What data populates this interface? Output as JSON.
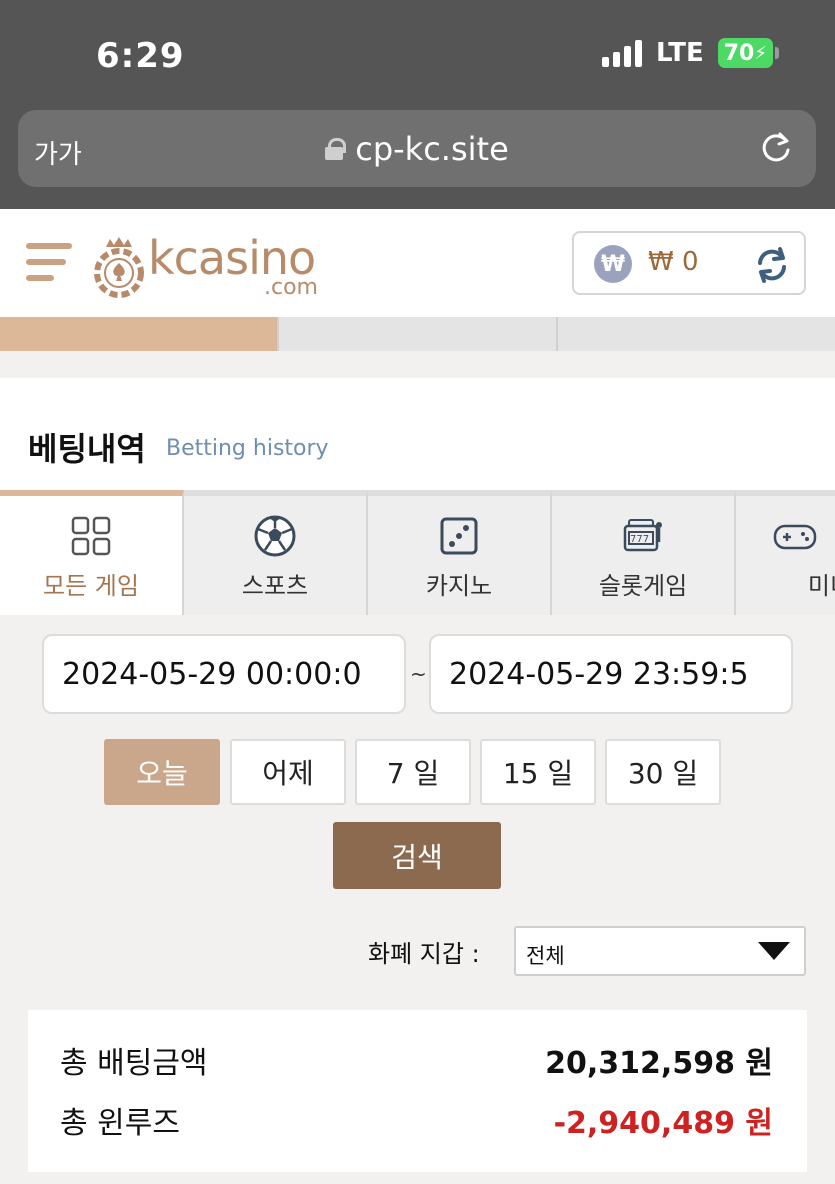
{
  "status_bar": {
    "time": "6:29",
    "network": "LTE",
    "battery": "70"
  },
  "browser": {
    "text_size": "가가",
    "url": "cp-kc.site"
  },
  "header": {
    "logo_text": "kcasino",
    "logo_sub": ".com",
    "balance": "₩ 0",
    "currency_symbol": "₩"
  },
  "page": {
    "title": "베팅내역",
    "subtitle": "Betting history"
  },
  "game_tabs": [
    {
      "label": "모든 게임",
      "icon": "grid-icon",
      "active": true
    },
    {
      "label": "스포츠",
      "icon": "soccer-ball-icon",
      "active": false
    },
    {
      "label": "카지노",
      "icon": "dice-icon",
      "active": false
    },
    {
      "label": "슬롯게임",
      "icon": "slot-machine-icon",
      "active": false
    },
    {
      "label": "미니",
      "icon": "gamepad-icon",
      "active": false
    }
  ],
  "date_range": {
    "start": "2024-05-29 00:00:0",
    "separator": "~",
    "end": "2024-05-29 23:59:5"
  },
  "quick_ranges": [
    {
      "label": "오늘",
      "active": true
    },
    {
      "label": "어제",
      "active": false
    },
    {
      "label": "7 일",
      "active": false
    },
    {
      "label": "15 일",
      "active": false
    },
    {
      "label": "30 일",
      "active": false
    }
  ],
  "search_label": "검색",
  "wallet": {
    "label": "화폐 지갑 :",
    "selected": "전체"
  },
  "summary": {
    "total_bet_label": "총 배팅금액",
    "total_bet_value": "20,312,598 원",
    "total_winloss_label": "총 윈루즈",
    "total_winloss_value": "-2,940,489 원"
  },
  "colors": {
    "accent": "#dcb899",
    "search_button": "#8c6a50",
    "negative": "#cc2222",
    "logo": "#b78b6a"
  }
}
